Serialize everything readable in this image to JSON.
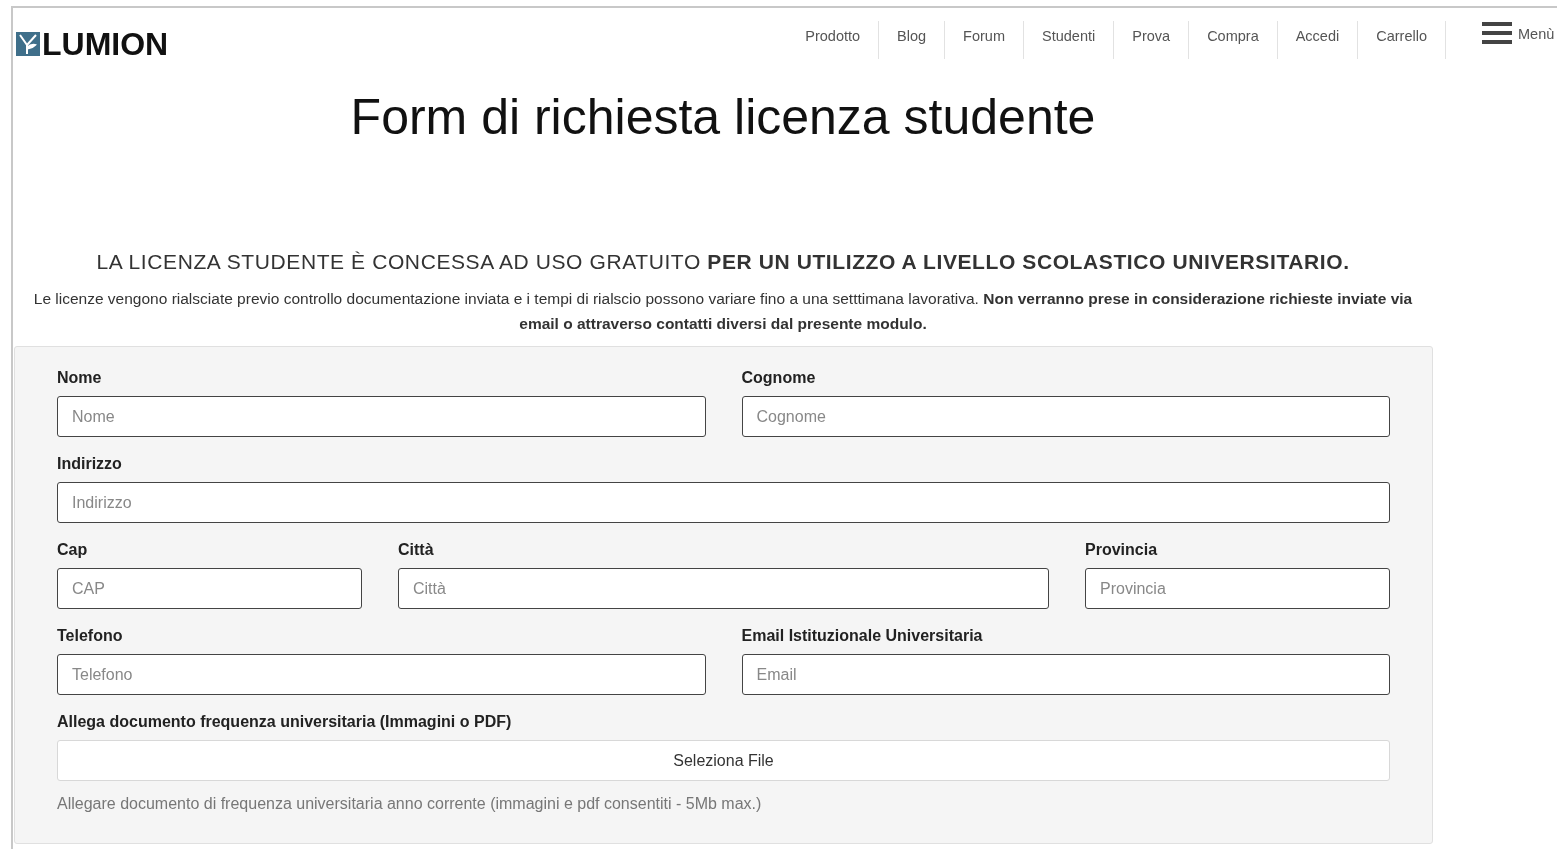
{
  "header": {
    "logo": "LUMION",
    "nav": [
      "Prodotto",
      "Blog",
      "Forum",
      "Studenti",
      "Prova",
      "Compra",
      "Accedi",
      "Carrello"
    ],
    "menu": "Menù"
  },
  "title": "Form di richiesta licenza studente",
  "headline": "LA LICENZA STUDENTE È CONCESSA AD USO GRATUITO **PER UN UTILIZZO A LIVELLO SCOLASTICO UNIVERSITARIO.**",
  "intro": "Le licenze vengono rialsciate previo controllo documentazione inviata e i tempi di rialscio possono variare fino a una setttimana lavorativa.  **Non verranno prese in considerazione richieste inviate via email o attraverso contatti diversi dal presente modulo.**",
  "form": {
    "rows": [
      {
        "kind": "pair",
        "fields": [
          {
            "label": "Nome",
            "placeholder": "Nome"
          },
          {
            "label": "Cognome",
            "placeholder": "Cognome"
          }
        ]
      },
      {
        "kind": "single",
        "fields": [
          {
            "label": "Indirizzo",
            "placeholder": "Indirizzo"
          }
        ]
      },
      {
        "kind": "triple",
        "fields": [
          {
            "label": "Cap",
            "placeholder": "CAP"
          },
          {
            "label": "Città",
            "placeholder": "Città"
          },
          {
            "label": "Provincia",
            "placeholder": "Provincia"
          }
        ]
      },
      {
        "kind": "pair",
        "fields": [
          {
            "label": "Telefono",
            "placeholder": "Telefono"
          },
          {
            "label": "Email Istituzionale Universitaria",
            "placeholder": "Email"
          }
        ]
      }
    ],
    "upload": {
      "label": "Allega documento frequenza universitaria (Immagini o PDF)",
      "button": "Seleziona File",
      "hint": "Allegare documento di frequenza universitaria anno corrente (immagini e pdf consentiti - 5Mb max.)"
    }
  }
}
